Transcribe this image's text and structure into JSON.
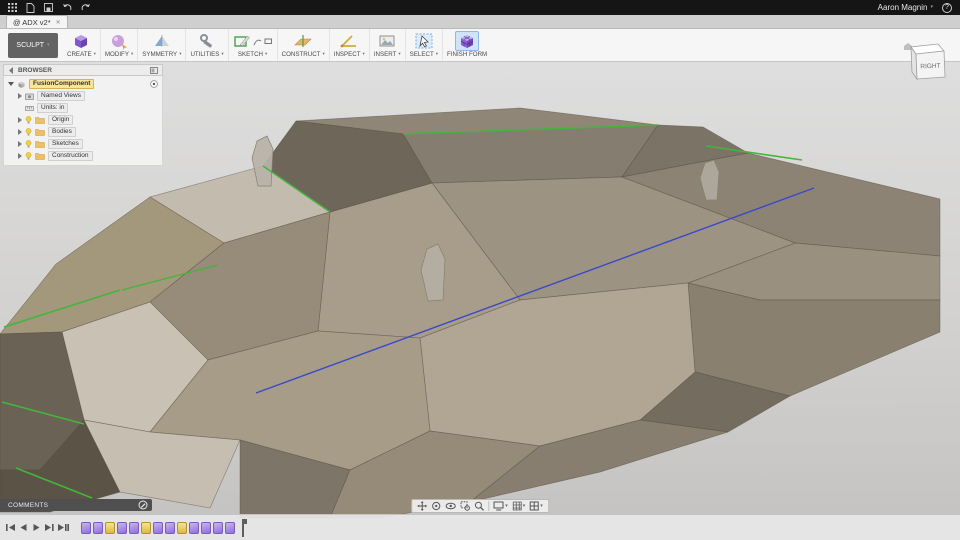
{
  "ui": {
    "caret": "▾",
    "close": "✕"
  },
  "topbar": {
    "user": "Aaron Magnin",
    "help": "?"
  },
  "tabbar": {
    "active_tab": "@ ADX v2*"
  },
  "toolbar": {
    "sculpt_label": "SCULPT",
    "groups": [
      {
        "label": "CREATE"
      },
      {
        "label": "MODIFY"
      },
      {
        "label": "SYMMETRY"
      },
      {
        "label": "UTILITIES"
      },
      {
        "label": "SKETCH"
      },
      {
        "label": "CONSTRUCT"
      },
      {
        "label": "INSPECT"
      },
      {
        "label": "INSERT"
      },
      {
        "label": "SELECT"
      },
      {
        "label": "FINISH FORM"
      }
    ]
  },
  "browser": {
    "title": "BROWSER",
    "root_label": "FusionComponent",
    "rows": [
      {
        "label": "Named Views"
      },
      {
        "label": "Units: in"
      },
      {
        "label": "Origin"
      },
      {
        "label": "Bodies"
      },
      {
        "label": "Sketches"
      },
      {
        "label": "Construction"
      }
    ]
  },
  "viewcube": {
    "face_label": "RIGHT"
  },
  "comments": {
    "label": "COMMENTS"
  },
  "canvas": {
    "edge_green": "#43b53c",
    "edge_blue": "#3a49c9"
  },
  "timeline": {
    "features": [
      {
        "icon": "form-feature-icon",
        "type": "purple"
      },
      {
        "icon": "form-feature-icon",
        "type": "purple"
      },
      {
        "icon": "sketch-feature-icon",
        "type": "yellow"
      },
      {
        "icon": "form-feature-icon",
        "type": "purple"
      },
      {
        "icon": "form-feature-icon",
        "type": "purple"
      },
      {
        "icon": "sketch-feature-icon",
        "type": "yellow"
      },
      {
        "icon": "form-feature-icon",
        "type": "purple"
      },
      {
        "icon": "form-feature-icon",
        "type": "purple"
      },
      {
        "icon": "sketch-feature-icon",
        "type": "yellow"
      },
      {
        "icon": "form-feature-icon",
        "type": "purple"
      },
      {
        "icon": "form-feature-icon",
        "type": "purple"
      },
      {
        "icon": "form-feature-icon",
        "type": "purple"
      },
      {
        "icon": "form-feature-icon",
        "type": "purple"
      }
    ]
  }
}
